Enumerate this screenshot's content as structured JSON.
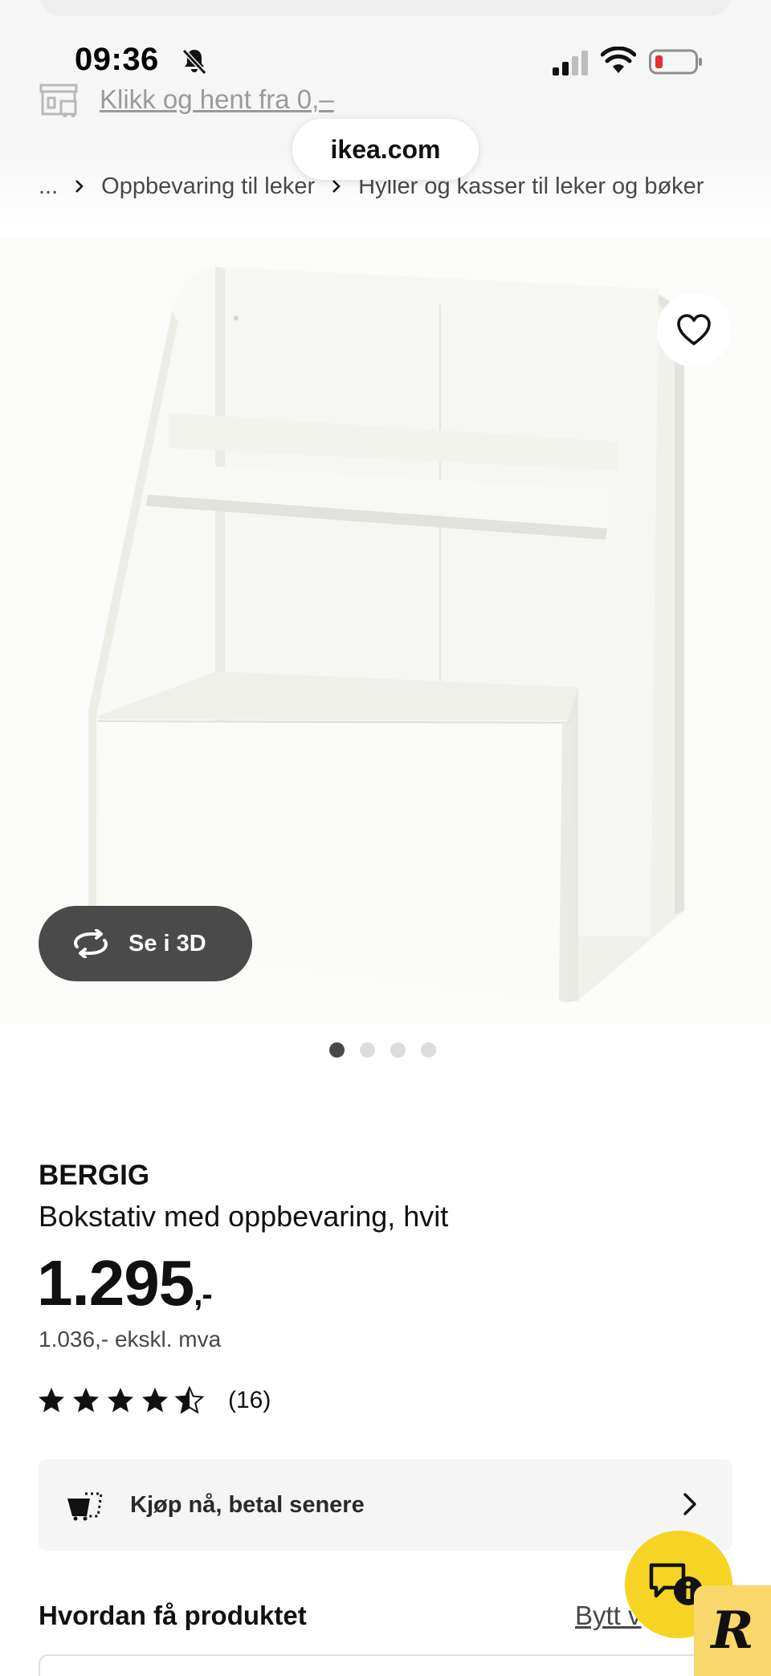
{
  "status_bar": {
    "time": "09:36",
    "icons": [
      "bell-muted-icon",
      "cellular-signal-icon",
      "wifi-icon",
      "battery-low-icon"
    ],
    "battery_color": "#e5322d"
  },
  "store_bar": {
    "icon": "store-icon",
    "link_text": "Klikk og hent fra 0,–"
  },
  "browser": {
    "url": "ikea.com"
  },
  "breadcrumb": {
    "ellipsis": "...",
    "items": [
      "Oppbevaring til leker",
      "Hyller og kasser til leker og bøker"
    ]
  },
  "gallery": {
    "favorite_icon": "heart-icon",
    "view_3d_label": "Se i 3D",
    "view_3d_icon": "rotate-3d-icon",
    "image_count": 4,
    "active_index": 0
  },
  "product": {
    "brand": "BERGIG",
    "description": "Bokstativ med oppbevaring, hvit",
    "price": "1.295",
    "price_suffix": ",-",
    "price_ex_vat": "1.036,- ekskl. mva",
    "rating": 4.5,
    "rating_max": 5,
    "review_count": "(16)"
  },
  "payment": {
    "label": "Kjøp nå, betal senere",
    "icon": "cart-icon"
  },
  "delivery": {
    "heading": "Hvordan få produktet",
    "change_link": "Bytt v"
  },
  "floating": {
    "chat_icon": "chat-info-icon",
    "chat_color": "#f5d423",
    "badge_letter": "R",
    "badge_color": "#f9d76a"
  }
}
